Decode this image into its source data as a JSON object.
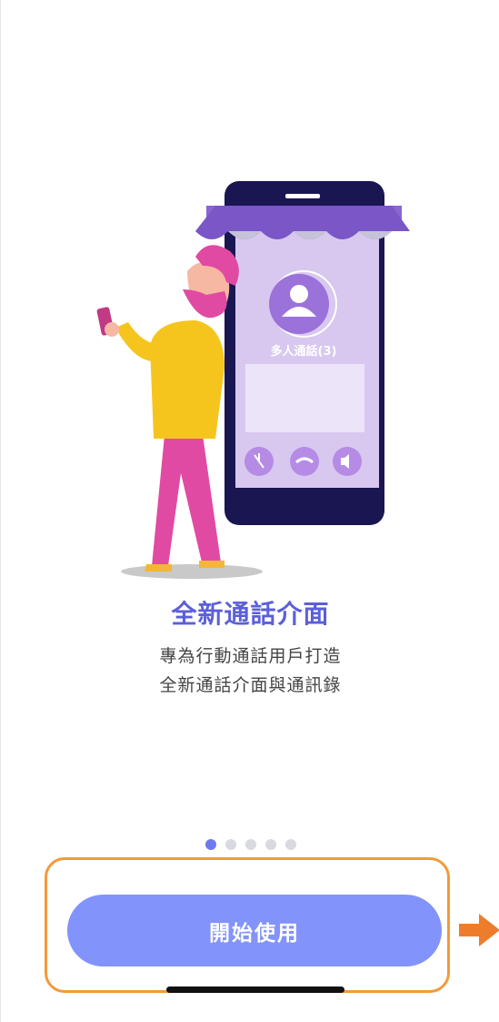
{
  "onboarding": {
    "call_screen_label": "多人通話(3)",
    "title": "全新通話介面",
    "subtitle_line1": "專為行動通話用戶打造",
    "subtitle_line2": "全新通話介面與通訊錄",
    "page_indicator": {
      "current": 1,
      "total": 5
    },
    "start_button_label": "開始使用"
  },
  "colors": {
    "accent": "#5b5fd9",
    "button": "#8293fb",
    "dot_active": "#6f79ee",
    "dot_inactive": "#d9d9e0",
    "highlight": "#f39a3b"
  }
}
